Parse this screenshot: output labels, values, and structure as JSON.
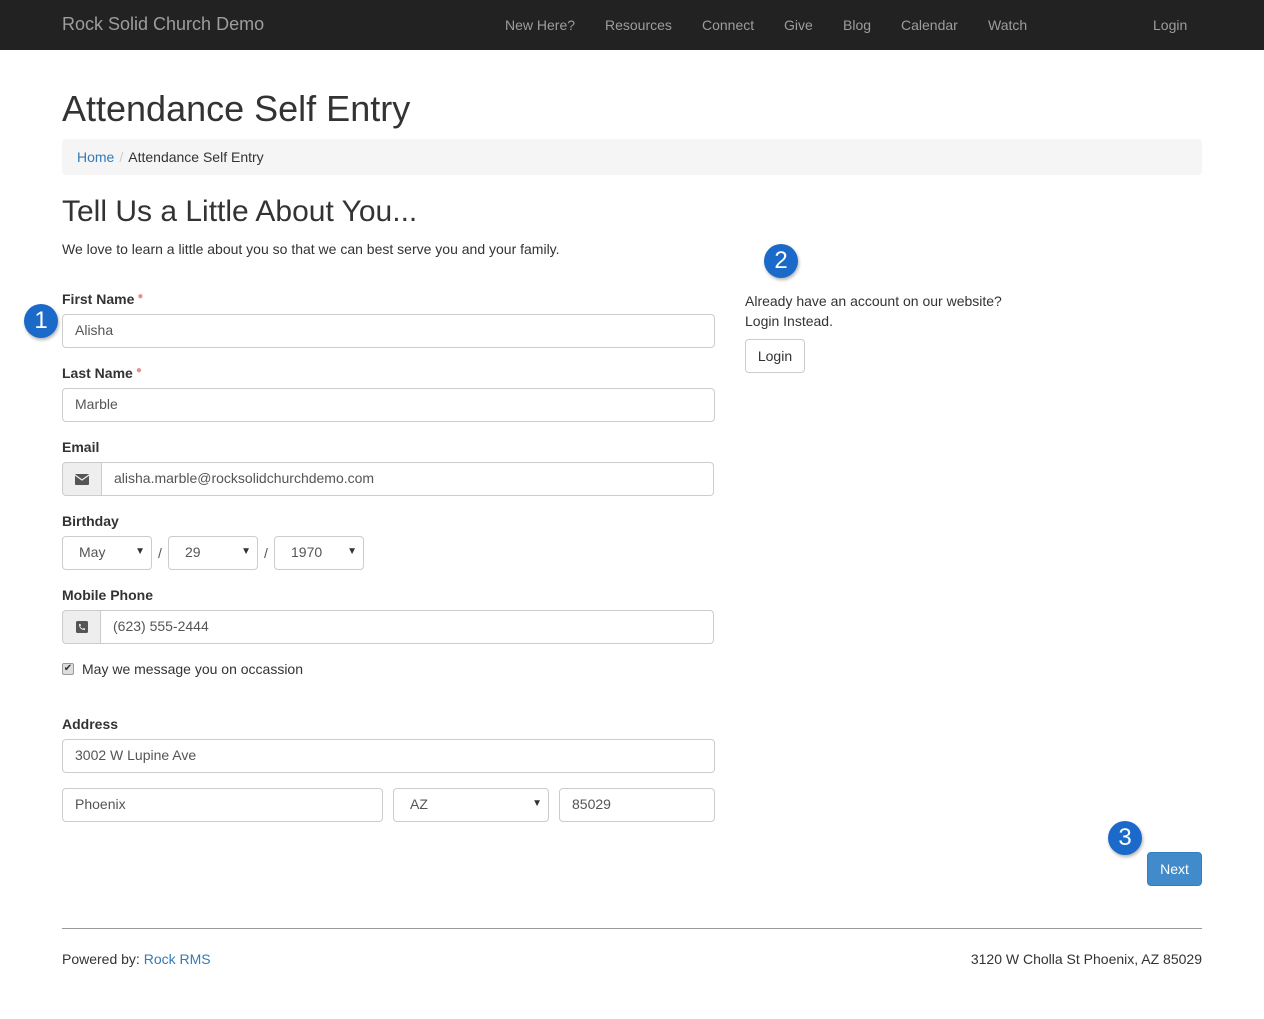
{
  "nav": {
    "brand": "Rock Solid Church Demo",
    "items": [
      "New Here?",
      "Resources",
      "Connect",
      "Give",
      "Blog",
      "Calendar",
      "Watch"
    ],
    "login": "Login"
  },
  "page": {
    "title": "Attendance Self Entry",
    "breadcrumb": {
      "home": "Home",
      "current": "Attendance Self Entry"
    }
  },
  "form": {
    "heading": "Tell Us a Little About You...",
    "intro": "We love to learn a little about you so that we can best serve you and your family.",
    "first_name": {
      "label": "First Name",
      "value": "Alisha"
    },
    "last_name": {
      "label": "Last Name",
      "value": "Marble"
    },
    "email": {
      "label": "Email",
      "value": "alisha.marble@rocksolidchurchdemo.com",
      "icon": "envelope-icon"
    },
    "birthday": {
      "label": "Birthday",
      "month": "May",
      "day": "29",
      "year": "1970",
      "separator": "/"
    },
    "mobile": {
      "label": "Mobile Phone",
      "value": "(623) 555-2444",
      "icon": "phone-icon"
    },
    "sms": {
      "label": "May we message you on occassion",
      "checked": true
    },
    "address": {
      "label": "Address",
      "street": "3002 W Lupine Ave",
      "city": "Phoenix",
      "state": "AZ",
      "zip": "85029"
    },
    "next": "Next"
  },
  "side": {
    "line1": "Already have an account on our website?",
    "line2": "Login Instead.",
    "login": "Login"
  },
  "badges": [
    "1",
    "2",
    "3"
  ],
  "footer": {
    "powered": "Powered by: ",
    "link": "Rock RMS",
    "address": "3120 W Cholla St Phoenix, AZ 85029"
  },
  "colors": {
    "navbar": "#222222",
    "badge": "#1b6ac9",
    "primary": "#428bca",
    "link": "#337ab7"
  }
}
